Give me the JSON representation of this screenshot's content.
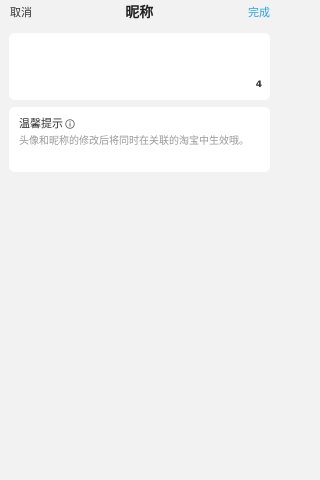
{
  "nav": {
    "cancel_label": "取消",
    "title": "昵称",
    "done_label": "完成"
  },
  "nickname": {
    "value": "",
    "char_count": "4"
  },
  "tip": {
    "title": "温馨提示",
    "text": "头像和昵称的修改后将同时在关联的淘宝中生效哦。"
  },
  "colors": {
    "accent": "#2aa3e8",
    "background": "#f2f2f2",
    "card": "#ffffff"
  }
}
